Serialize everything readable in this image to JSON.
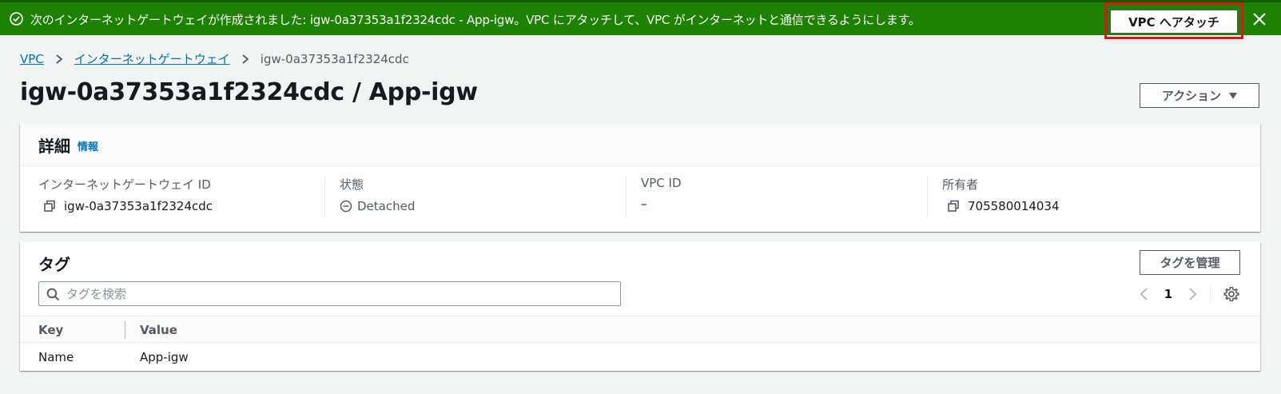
{
  "flash": {
    "message": "次のインターネットゲートウェイが作成されました: igw-0a37353a1f2324cdc - App-igw。VPC にアタッチして、VPC がインターネットと通信できるようにします。",
    "attach_label": "VPC へアタッチ"
  },
  "breadcrumb": {
    "items": [
      "VPC",
      "インターネットゲートウェイ"
    ],
    "current": "igw-0a37353a1f2324cdc"
  },
  "page": {
    "title": "igw-0a37353a1f2324cdc / App-igw",
    "actions_label": "アクション"
  },
  "details": {
    "heading": "詳細",
    "info_link": "情報",
    "fields": [
      {
        "label": "インターネットゲートウェイ ID",
        "value": "igw-0a37353a1f2324cdc"
      },
      {
        "label": "状態",
        "value": "Detached"
      },
      {
        "label": "VPC ID",
        "value": "–"
      },
      {
        "label": "所有者",
        "value": "705580014034"
      }
    ]
  },
  "tags": {
    "heading": "タグ",
    "manage_label": "タグを管理",
    "search_placeholder": "タグを検索",
    "page_number": "1",
    "columns": [
      "Key",
      "Value"
    ],
    "rows": [
      {
        "key": "Name",
        "value": "App-igw"
      }
    ]
  },
  "colors": {
    "success_green": "#1d8102",
    "link_blue": "#0073bb",
    "highlight_red": "#e0121a"
  }
}
